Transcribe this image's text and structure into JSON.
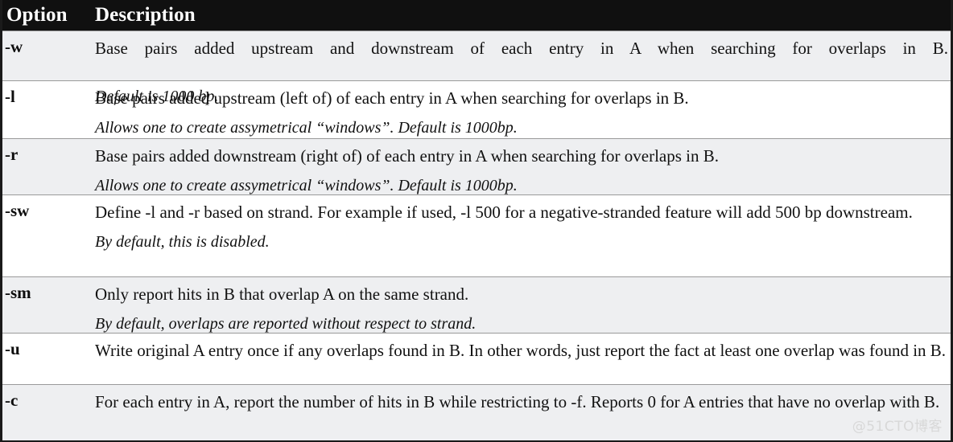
{
  "table": {
    "headers": {
      "option": "Option",
      "description": "Description"
    },
    "colors": {
      "header_background": "#101010",
      "header_text": "#ffffff",
      "row_shaded": "#eeeff1",
      "row_plain": "#ffffff",
      "border": "#1a1a1a",
      "body_text": "#111111",
      "watermark": "#d8d8d8"
    },
    "rows": [
      {
        "option": "-w",
        "description": "Base pairs added upstream and downstream of each entry in A when searching for overlaps in B.",
        "note": "Default is 1000 bp."
      },
      {
        "option": "-l",
        "description": "Base pairs added upstream (left of) of each entry in A when searching for overlaps in B.",
        "note": "Allows one to create assymetrical “windows”. Default is 1000bp."
      },
      {
        "option": "-r",
        "description": "Base pairs added downstream (right of) of each entry in A when searching for overlaps in B.",
        "note": "Allows one to create assymetrical “windows”. Default is 1000bp."
      },
      {
        "option": "-sw",
        "description": "Define -l and -r based on strand.  For example if used, -l 500 for a negative-stranded feature will add 500 bp downstream.",
        "note": "By default, this is disabled."
      },
      {
        "option": "-sm",
        "description": "Only report hits in B that overlap A on the same strand.",
        "note": "By default, overlaps are reported without respect to strand."
      },
      {
        "option": "-u",
        "description": "Write original A entry once if any overlaps found in B. In other words, just report the fact at least one overlap was found in B.",
        "note": ""
      },
      {
        "option": "-c",
        "description": "For each entry in A, report the number of hits in B while restricting to -f. Reports 0 for A entries that have no overlap with B.",
        "note": ""
      }
    ]
  },
  "watermark": {
    "text": "@51CTO博客"
  }
}
